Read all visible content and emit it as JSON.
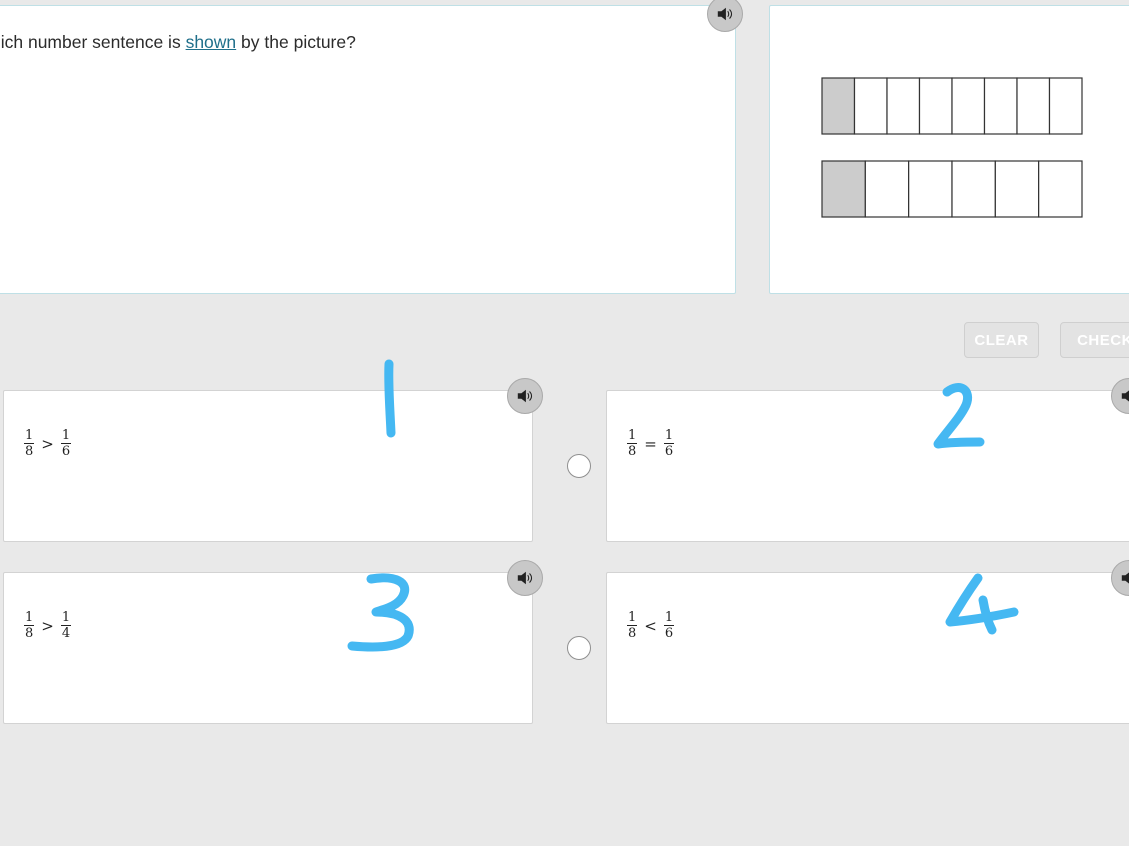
{
  "question": {
    "text_before": "hich number sentence is",
    "link": "shown",
    "text_after": "by the picture?"
  },
  "picture": {
    "bars": [
      {
        "parts": 8,
        "shaded": 1
      },
      {
        "parts": 6,
        "shaded": 1
      }
    ],
    "shade_color": "#cccccc",
    "line_color": "#333333"
  },
  "buttons": {
    "clear": "CLEAR",
    "check": "CHECK"
  },
  "choices": [
    {
      "left": {
        "num": "1",
        "den": "8"
      },
      "op": ">",
      "right": {
        "num": "1",
        "den": "6"
      }
    },
    {
      "left": {
        "num": "1",
        "den": "8"
      },
      "op": "=",
      "right": {
        "num": "1",
        "den": "6"
      }
    },
    {
      "left": {
        "num": "1",
        "den": "8"
      },
      "op": ">",
      "right": {
        "num": "1",
        "den": "4"
      }
    },
    {
      "left": {
        "num": "1",
        "den": "8"
      },
      "op": "<",
      "right": {
        "num": "1",
        "den": "6"
      }
    }
  ],
  "annotation_color": "#45b8f2",
  "icons": {
    "audio": "speaker-icon"
  }
}
